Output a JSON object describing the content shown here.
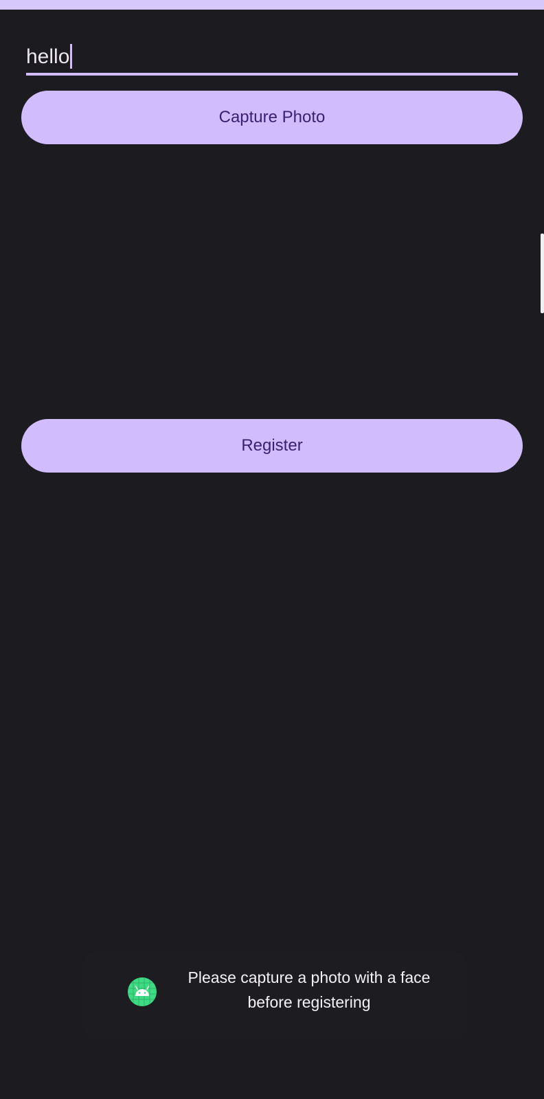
{
  "form": {
    "name_value": "hello",
    "capture_label": "Capture Photo",
    "register_label": "Register"
  },
  "toast": {
    "icon": "android-icon",
    "message": "Please capture a photo with a face before registering"
  },
  "colors": {
    "background": "#1c1b20",
    "button_fill": "#d1bcfd",
    "button_text": "#3b1f72",
    "input_underline": "#d2bcfd",
    "android_green": "#3ddc84"
  }
}
